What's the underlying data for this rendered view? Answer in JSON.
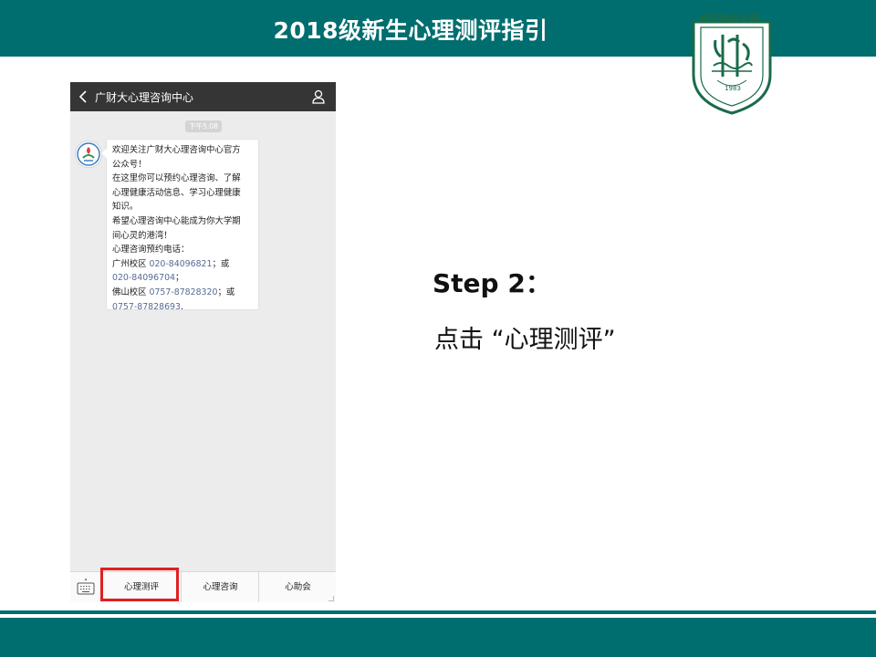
{
  "slide": {
    "title": "2018级新生心理测评指引",
    "step_title": "Step 2：",
    "step_desc": "点击 “心理测评”"
  },
  "logo": {
    "cn_name": "廣東財經大學",
    "en_name": "GUANGDONG UNIVERSITY OF FINANCE & ECONOMICS",
    "year": "1983"
  },
  "phone": {
    "header_title": "广财大心理咨询中心",
    "timestamp": "下午5:08",
    "message_lines": [
      {
        "text": "欢迎关注广财大心理咨询中心官方",
        "link": ""
      },
      {
        "text": "公众号！",
        "link": ""
      },
      {
        "text": "在这里你可以预约心理咨询、了解",
        "link": ""
      },
      {
        "text": "心理健康活动信息、学习心理健康",
        "link": ""
      },
      {
        "text": "知识。",
        "link": ""
      },
      {
        "text": "希望心理咨询中心能成为你大学期",
        "link": ""
      },
      {
        "text": "间心灵的港湾！",
        "link": ""
      },
      {
        "text": "心理咨询预约电话：",
        "link": ""
      }
    ],
    "phone_line1": {
      "prefix": "广州校区 ",
      "number": "020-84096821",
      "suffix": "；或"
    },
    "phone_line2": {
      "number": "020-84096704",
      "suffix": "；"
    },
    "phone_line3": {
      "prefix": "佛山校区 ",
      "number": "0757-87828320",
      "suffix": "；或"
    },
    "phone_line4": {
      "number": "0757-87828693",
      "suffix": "."
    },
    "menu": [
      "心理测评",
      "心理咨询",
      "心助会"
    ]
  },
  "colors": {
    "brand": "#006d6f",
    "highlight": "#e02020",
    "link": "#576b95"
  }
}
